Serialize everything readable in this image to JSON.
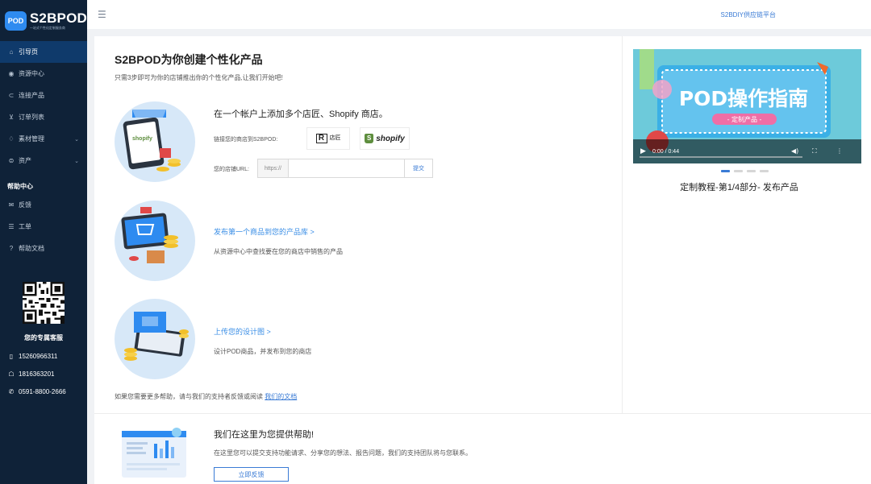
{
  "brand": {
    "badge": "POD",
    "name": "S2BPOD",
    "tagline": "一站式个性化定制服务商"
  },
  "sidebar": {
    "items": [
      {
        "icon": "home-icon",
        "label": "引导页",
        "active": true
      },
      {
        "icon": "eye-icon",
        "label": "资源中心"
      },
      {
        "icon": "link-icon",
        "label": "连接产品"
      },
      {
        "icon": "cart-icon",
        "label": "订单列表"
      },
      {
        "icon": "gift-icon",
        "label": "素材管理",
        "expandable": true
      },
      {
        "icon": "wallet-icon",
        "label": "资产",
        "expandable": true
      }
    ],
    "help_title": "帮助中心",
    "help_items": [
      {
        "icon": "mail-icon",
        "label": "反馈"
      },
      {
        "icon": "list-icon",
        "label": "工单"
      },
      {
        "icon": "question-icon",
        "label": "帮助文档"
      }
    ],
    "service_title": "您的专属客服",
    "contacts": [
      {
        "icon": "phone-icon",
        "value": "15260966311"
      },
      {
        "icon": "qq-icon",
        "value": "1816363201"
      },
      {
        "icon": "telephone-icon",
        "value": "0591-8800-2666"
      }
    ]
  },
  "header": {
    "platform_link": "S2BDIY供应链平台"
  },
  "guide": {
    "title": "S2BPOD为你创建个性化产品",
    "subtitle": "只需3步即可为你的店铺推出你的个性化产品,让我们开始吧!",
    "step1": {
      "title": "在一个帐户上添加多个店匠、Shopify 商店。",
      "link_label": "链接您的商店到S2BPOD:",
      "store_rj_mark": "R",
      "store_rj_text": "店匠",
      "store_shopify_mark": "S",
      "store_shopify_text": "shopify",
      "url_label": "您的店铺URL:",
      "url_prefix": "https://",
      "url_value": "",
      "submit_label": "提交"
    },
    "step2": {
      "link": "发布第一个商品到您的产品库 >",
      "desc": "从资源中心中查找要在您的商店中销售的产品"
    },
    "step3": {
      "link": "上传您的设计图 >",
      "desc": "设计POD商品，并发布到您的商店"
    },
    "footer_text": "如果您需要更多帮助，请与我们的支持者反馈或阅读 ",
    "footer_link": "我们的文档"
  },
  "video": {
    "banner_title": "POD操作指南",
    "banner_sub": "- 定制产品 -",
    "time": "0:00 / 0:44",
    "caption": "定制教程-第1/4部分- 发布产品",
    "slides": 4,
    "active_slide": 0,
    "progress": 0
  },
  "help": {
    "title": "我们在这里为您提供帮助!",
    "desc": "在这里您可以提交支持功能请求、分享您的想法、报告问题，我们的支持团队将与您联系。",
    "button": "立即反馈"
  }
}
